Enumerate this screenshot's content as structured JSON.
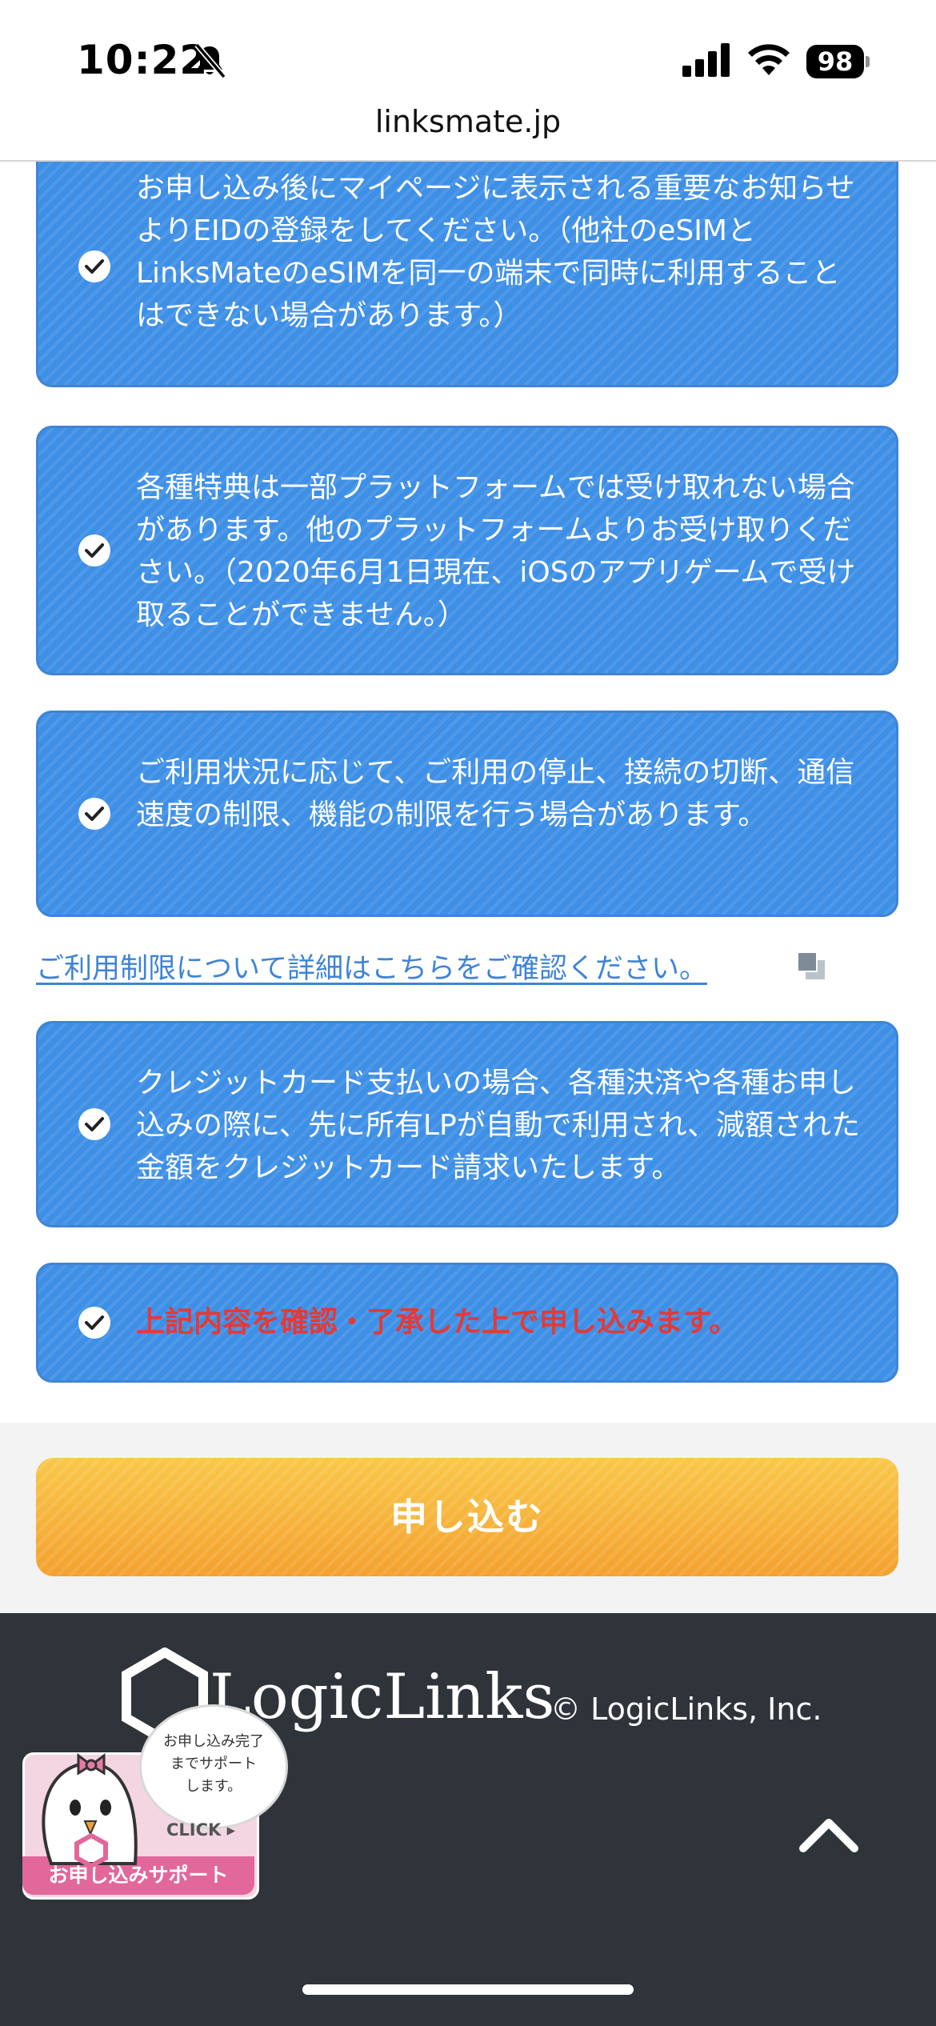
{
  "status_bar": {
    "time": "10:22",
    "battery": "98"
  },
  "browser": {
    "url": "linksmate.jp"
  },
  "checklist": [
    {
      "text": "お申し込み後にマイページに表示される重要なお知らせよりEIDの登録をしてください。（他社のeSIMとLinksMateのeSIMを同一の端末で同時に利用することはできない場合があります。）",
      "checked": true
    },
    {
      "text": "各種特典は一部プラットフォームでは受け取れない場合があります。他のプラットフォームよりお受け取りください。（2020年6月1日現在、iOSのアプリゲームで受け取ることができません。）",
      "checked": true
    },
    {
      "text": "ご利用状況に応じて、ご利用の停止、接続の切断、通信速度の制限、機能の制限を行う場合があります。",
      "checked": true
    },
    {
      "text": "クレジットカード支払いの場合、各種決済や各種お申し込みの際に、先に所有LPが自動で利用され、減額された金額をクレジットカード請求いたします。",
      "checked": true
    },
    {
      "text": "上記内容を確認・了承した上で申し込みます。",
      "checked": true
    }
  ],
  "detail_link": "ご利用制限について詳細はこちらをご確認ください。",
  "submit": {
    "label": "申し込む"
  },
  "footer": {
    "logo": "LogicLinks",
    "copyright": "© LogicLinks, Inc."
  },
  "support_badge": {
    "bubble_lines": [
      "お申し込み完了",
      "までサポート",
      "します。"
    ],
    "click": "CLICK",
    "label": "お申し込みサポート"
  },
  "colors": {
    "check_bg": "#3e8fe6",
    "check_border": "#3f84d6",
    "agree_text": "#e53935",
    "submit_bg": "#f7b03a",
    "footer_bg": "#2f343a",
    "link": "#3f84d6"
  }
}
